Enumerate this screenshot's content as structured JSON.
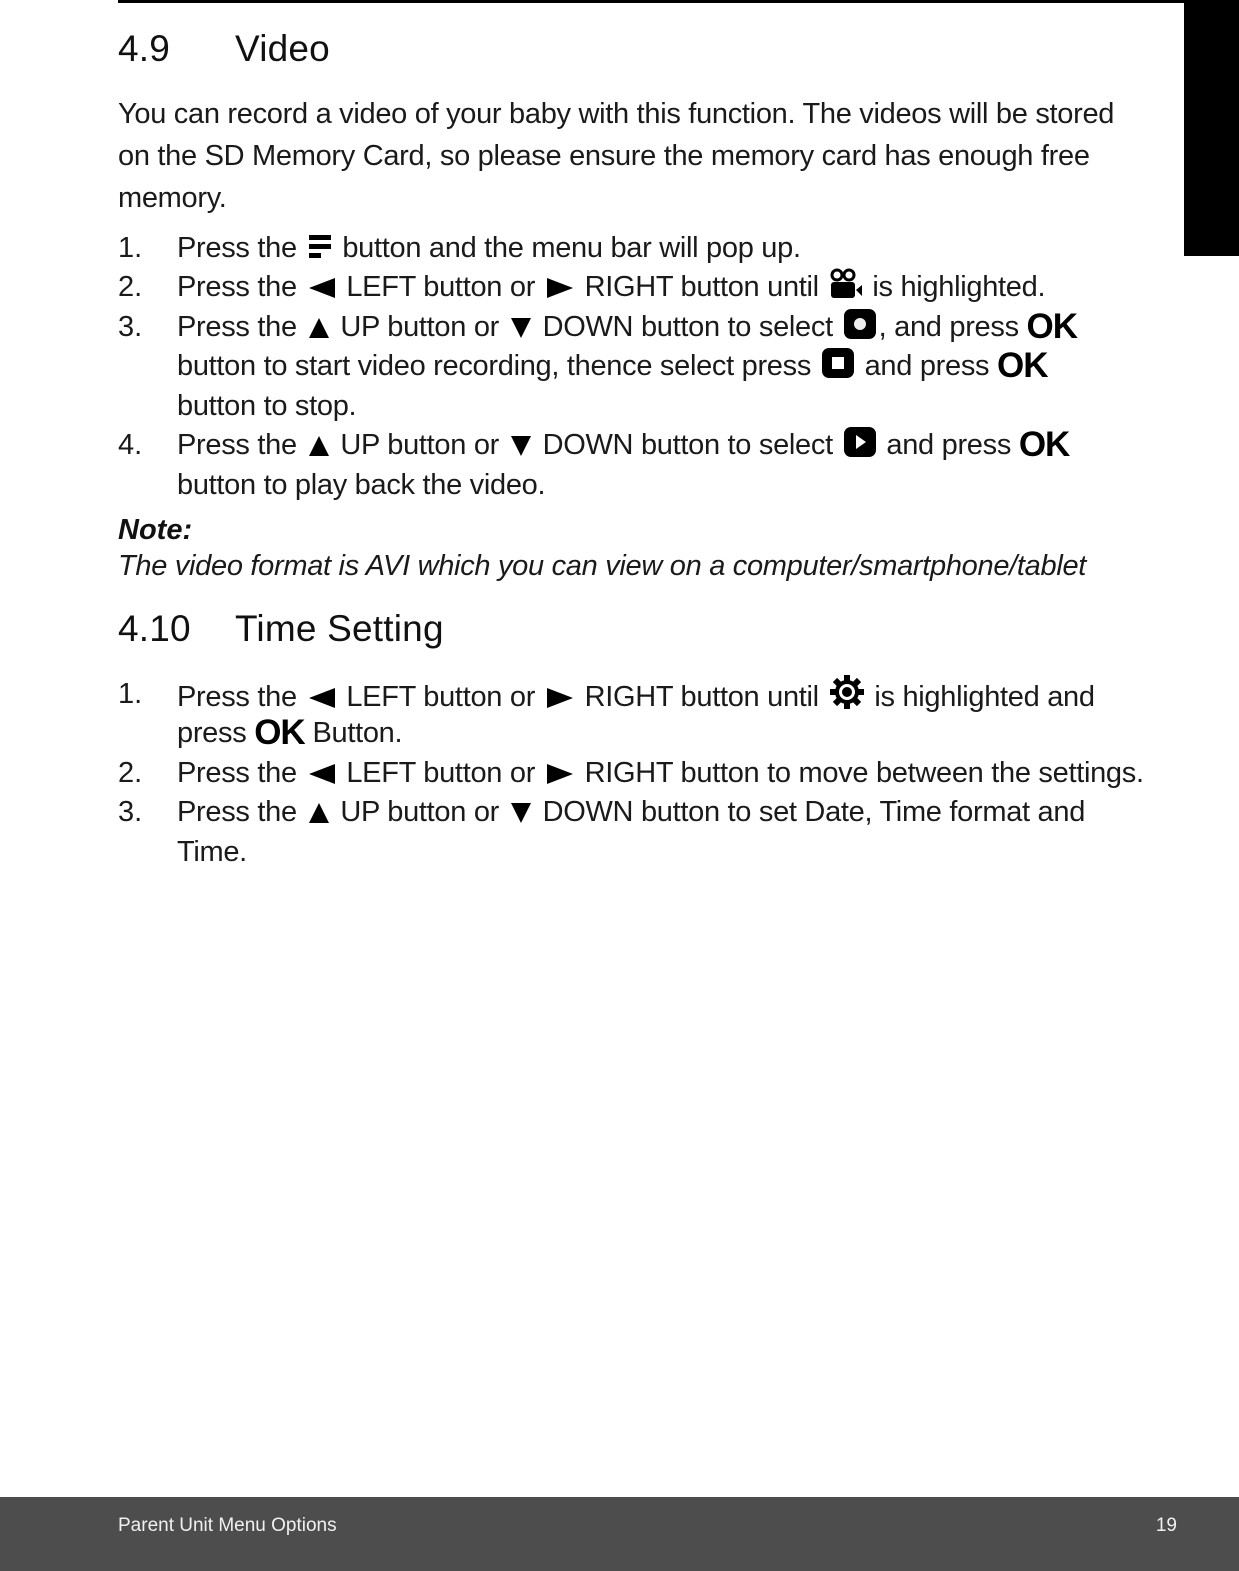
{
  "sections": [
    {
      "number": "4.9",
      "title": "Video",
      "intro_lines": [
        "You can record a video of your baby with this function. The videos will be stored",
        "on the SD Memory Card, so please ensure the memory card has enough free",
        "memory."
      ],
      "steps": [
        {
          "n": "1.",
          "a": "Press the",
          "b": "button and the menu bar will pop up."
        },
        {
          "n": "2.",
          "a": "Press the",
          "b": "LEFT button or",
          "c": "RIGHT button until",
          "d": "is highlighted."
        },
        {
          "n": "3.",
          "a": "Press the",
          "b": "UP button or",
          "c": "DOWN button to select",
          "d": ", and press",
          "line2a": "button to start video recording, thence select press",
          "line2b": "and press",
          "line3": "button to stop."
        },
        {
          "n": "4.",
          "a": "Press the",
          "b": "UP button or",
          "c": "DOWN button to select",
          "d": "and press",
          "line2": "button to play back the video."
        }
      ],
      "note": {
        "title": "Note:",
        "text": "The video format is AVI which you can view on a computer/smartphone/tablet"
      }
    },
    {
      "number": "4.10",
      "title": "Time Setting",
      "steps": [
        {
          "n": "1.",
          "a": "Press the",
          "b": "LEFT button or",
          "c": "RIGHT button until",
          "d": "is highlighted and",
          "line2a": "press",
          "line2b": "Button."
        },
        {
          "n": "2.",
          "a": "Press the",
          "b": "LEFT button or",
          "c": "RIGHT button to move between the settings."
        },
        {
          "n": "3.",
          "a": "Press the",
          "b": "UP button or",
          "c": "DOWN button to set Date, Time format and",
          "line2": "Time."
        }
      ]
    }
  ],
  "ok_label": "OK",
  "icons": {
    "menu": "menu-bars-icon",
    "left": "left-triangle-icon",
    "right": "right-triangle-icon",
    "up": "up-triangle-icon",
    "down": "down-triangle-icon",
    "video": "video-camera-icon",
    "record": "record-icon",
    "stop": "stop-icon",
    "play": "play-icon",
    "settings": "gear-icon"
  },
  "footer": {
    "title": "Parent Unit Menu Options",
    "page": "19"
  },
  "colors": {
    "footer_bg": "#4d4d4d",
    "text": "#1a1a1a",
    "tab": "#000000"
  }
}
